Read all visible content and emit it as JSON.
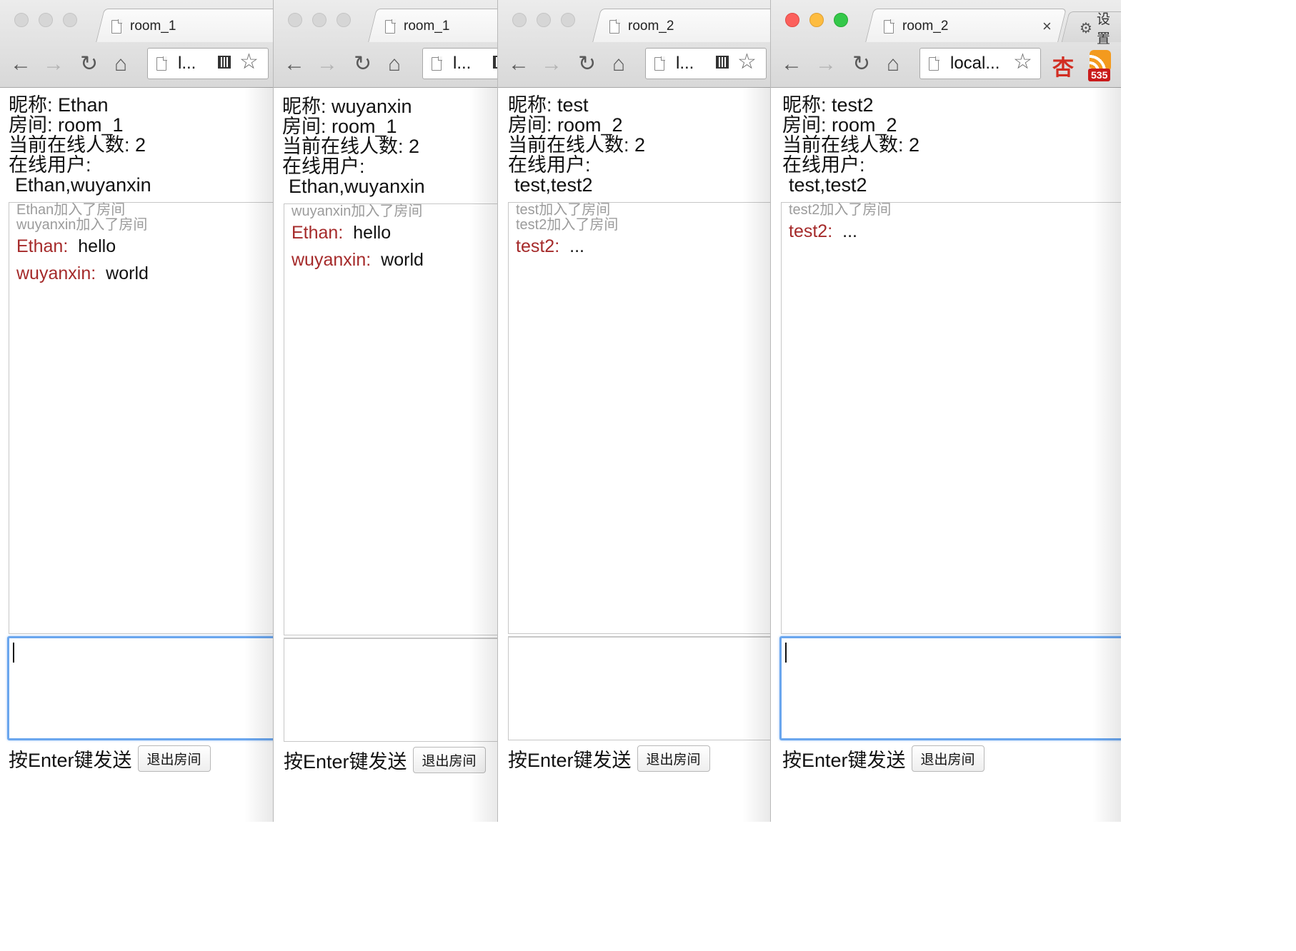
{
  "windows": [
    {
      "tab_title": "room_1",
      "url": "l...",
      "info": {
        "nickname": "昵称: Ethan",
        "room": "房间: room_1",
        "online_count": "当前在线人数: 2",
        "online_users_label": "在线用户:",
        "online_users": "Ethan,wuyanxin"
      },
      "system_messages": [
        "Ethan加入了房间",
        "wuyanxin加入了房间"
      ],
      "messages": [
        {
          "who": "Ethan:",
          "what": "hello"
        },
        {
          "who": "wuyanxin:",
          "what": "world"
        }
      ],
      "hint": "按Enter键发送",
      "leave_label": "退出房间"
    },
    {
      "tab_title": "room_1",
      "url": "l...",
      "info": {
        "nickname": "昵称: wuyanxin",
        "room": "房间: room_1",
        "online_count": "当前在线人数: 2",
        "online_users_label": "在线用户:",
        "online_users": "Ethan,wuyanxin"
      },
      "system_messages": [
        "wuyanxin加入了房间"
      ],
      "messages": [
        {
          "who": "Ethan:",
          "what": "hello"
        },
        {
          "who": "wuyanxin:",
          "what": "world"
        }
      ],
      "hint": "按Enter键发送",
      "leave_label": "退出房间"
    },
    {
      "tab_title": "room_2",
      "url": "l...",
      "info": {
        "nickname": "昵称: test",
        "room": "房间: room_2",
        "online_count": "当前在线人数: 2",
        "online_users_label": "在线用户:",
        "online_users": "test,test2"
      },
      "system_messages": [
        "test加入了房间",
        "test2加入了房间"
      ],
      "messages": [
        {
          "who": "test2:",
          "what": "..."
        }
      ],
      "hint": "按Enter键发送",
      "leave_label": "退出房间"
    },
    {
      "tab_title": "room_2",
      "url": "local...",
      "info": {
        "nickname": "昵称: test2",
        "room": "房间: room_2",
        "online_count": "当前在线人数: 2",
        "online_users_label": "在线用户:",
        "online_users": "test,test2"
      },
      "system_messages": [
        "test2加入了房间"
      ],
      "messages": [
        {
          "who": "test2:",
          "what": "..."
        }
      ],
      "hint": "按Enter键发送",
      "leave_label": "退出房间",
      "second_tab_label": "设置",
      "close_icon": "×",
      "rss_badge": "535",
      "apricot_ext": "杏"
    }
  ],
  "icons": {
    "back": "arrow-left-icon",
    "forward": "arrow-right-icon",
    "reload": "reload-icon",
    "home": "home-icon",
    "star": "bookmark-star-icon",
    "qr": "qr-code-icon",
    "gear": "gear-icon",
    "rss": "rss-icon"
  },
  "colors": {
    "username": "#a52a2a",
    "system_message": "#9c9c9c",
    "focus_border": "#6aa6ee"
  }
}
